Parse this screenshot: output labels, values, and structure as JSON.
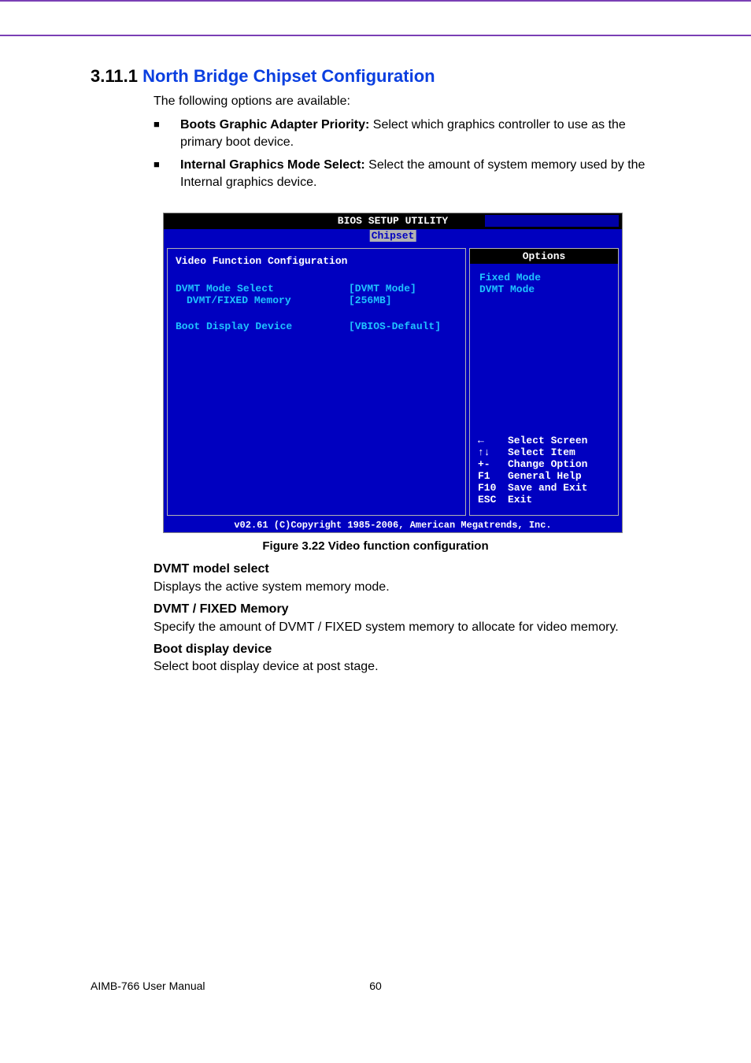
{
  "section": {
    "number": "3.11.1",
    "title": "North Bridge Chipset Configuration"
  },
  "intro": "The following options are available:",
  "options": [
    {
      "bold": "Boots Graphic Adapter Priority:",
      "rest": " Select which graphics controller to use as the primary boot device."
    },
    {
      "bold": "Internal Graphics Mode Select:",
      "rest": " Select the amount of system memory used by the Internal graphics device."
    }
  ],
  "bios": {
    "title": "BIOS SETUP UTILITY",
    "tab": "Chipset",
    "left_heading": "Video Function Configuration",
    "rows": [
      {
        "label": "DVMT Mode Select",
        "value": "[DVMT Mode]"
      },
      {
        "label": "DVMT/FIXED Memory",
        "value": "[256MB]",
        "indent": true
      }
    ],
    "rows2": [
      {
        "label": "Boot Display Device",
        "value": "[VBIOS-Default]"
      }
    ],
    "options_header": "Options",
    "options_list": [
      "Fixed Mode",
      "DVMT Mode"
    ],
    "help": [
      {
        "k": "←",
        "v": "Select Screen"
      },
      {
        "k": "↑↓",
        "v": "Select Item"
      },
      {
        "k": "+-",
        "v": "Change Option"
      },
      {
        "k": "F1",
        "v": "General Help"
      },
      {
        "k": "F10",
        "v": "Save and Exit"
      },
      {
        "k": "ESC",
        "v": "Exit"
      }
    ],
    "footer": "v02.61 (C)Copyright 1985-2006, American Megatrends, Inc."
  },
  "figure_caption": "Figure 3.22 Video function configuration",
  "definitions": [
    {
      "term": "DVMT model select",
      "desc": "Displays the active system memory mode."
    },
    {
      "term": "DVMT / FIXED Memory",
      "desc": "Specify the amount of DVMT / FIXED system memory to allocate for video memory."
    },
    {
      "term": "Boot display device",
      "desc": "Select boot display device at post stage."
    }
  ],
  "footer": {
    "manual": "AIMB-766 User Manual",
    "page": "60"
  }
}
